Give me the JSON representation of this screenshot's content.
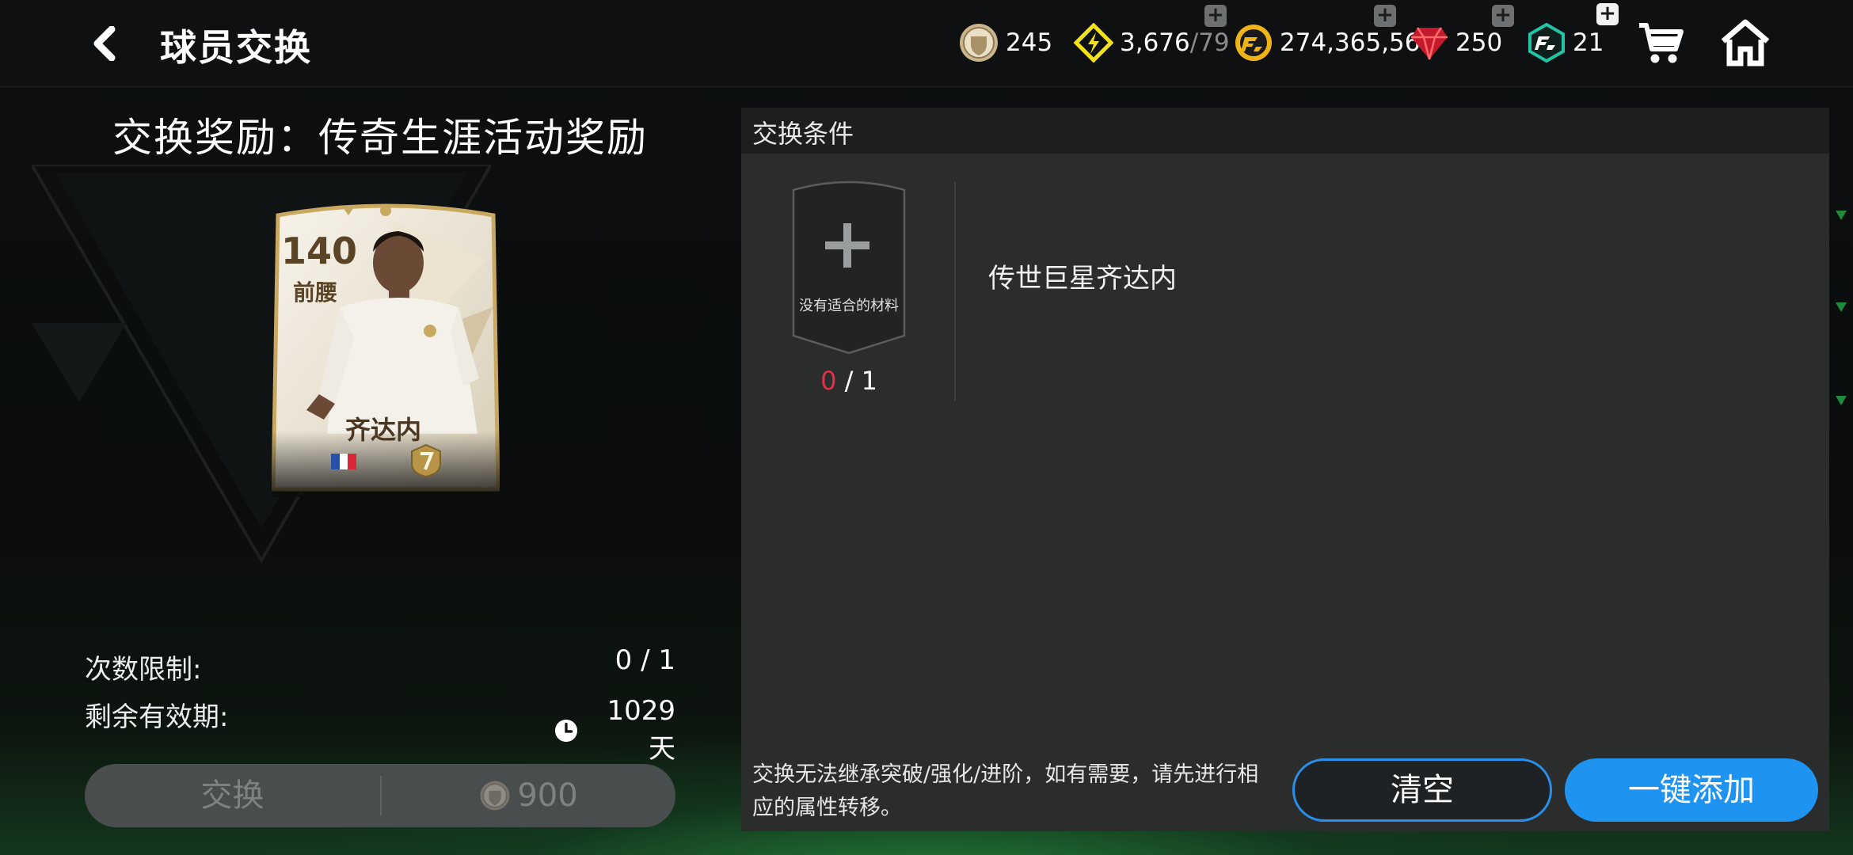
{
  "header": {
    "title": "球员交换",
    "currencies": [
      {
        "name": "token",
        "value": "245"
      },
      {
        "name": "energy",
        "value": "3,676",
        "max": "/79"
      },
      {
        "name": "coins",
        "value": "274,365,562"
      },
      {
        "name": "gems",
        "value": "250"
      },
      {
        "name": "fc-points",
        "value": "21"
      }
    ]
  },
  "reward": {
    "title": "交换奖励：传奇生涯活动奖励",
    "card": {
      "rating": "140",
      "position": "前腰",
      "name": "齐达内"
    }
  },
  "limits": {
    "count_label": "次数限制:",
    "count_value": "0 / 1",
    "validity_label": "剩余有效期:",
    "validity_value": "1029天"
  },
  "exchange_button": {
    "label": "交换",
    "cost": "900"
  },
  "conditions": {
    "header": "交换条件",
    "slot_text": "没有适合的材料",
    "slot_current": "0",
    "slot_total": " / 1",
    "requirement": "传世巨星齐达内",
    "notice": "交换无法继承突破/强化/进阶，如有需要，请先进行相应的属性转移。",
    "clear_label": "清空",
    "auto_add_label": "一键添加"
  },
  "colors": {
    "accent_blue": "#1f93f0",
    "count_red": "#e0304a",
    "panel_bg": "#2b2c2c"
  }
}
